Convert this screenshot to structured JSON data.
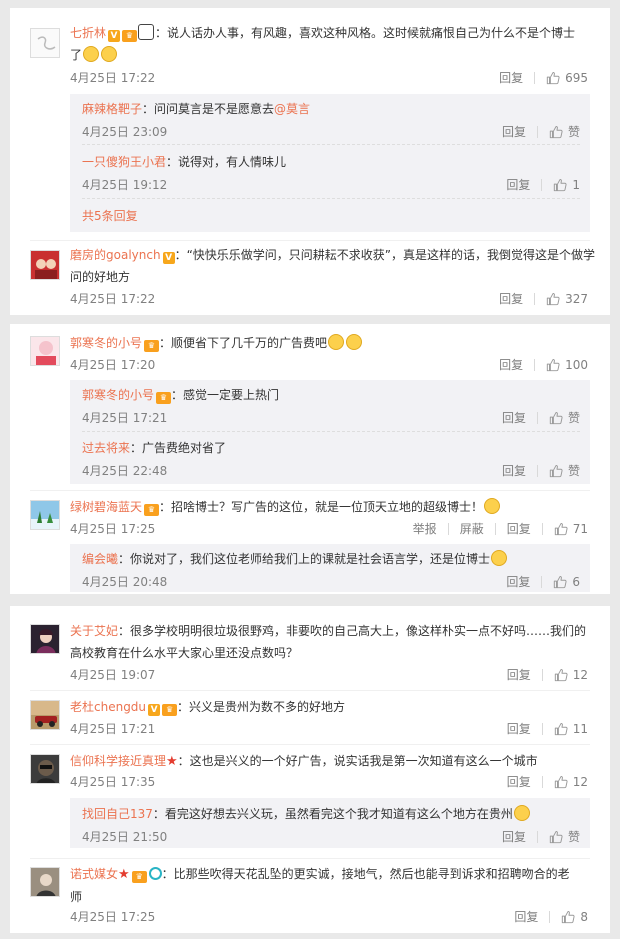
{
  "panel1": {
    "c1": {
      "name": "七折林",
      "text": "：说人话办人事，有风趣，喜欢这种风格。这时候就痛恨自己为什么不是个博士",
      "text2": "了",
      "time": "4月25日 17:22",
      "reply": "回复",
      "likes": "695",
      "subs": [
        {
          "name": "麻辣格靶子",
          "text": "：问问莫言是不是愿意去",
          "mention": "@莫言",
          "time": "4月25日 23:09",
          "reply": "回复",
          "likes": "赞"
        },
        {
          "name": "一只傻狗王小君",
          "text": "：说得对，有人情味儿",
          "time": "4月25日 19:12",
          "reply": "回复",
          "likes": "1"
        }
      ],
      "more": "共5条回复"
    },
    "c2": {
      "name": "磨房的goalynch",
      "text": "：“快快乐乐做学问，只问耕耘不求收获”，真是这样的话，我倒觉得这是个做学",
      "text2": "问的好地方",
      "time": "4月25日 17:22",
      "reply": "回复",
      "likes": "327"
    }
  },
  "panel2": {
    "c1": {
      "name": "郭寒冬的小号",
      "text": "：顺便省下了几千万的广告费吧",
      "time": "4月25日 17:20",
      "reply": "回复",
      "likes": "100",
      "subs": [
        {
          "name": "郭寒冬的小号",
          "text": "：感觉一定要上热门",
          "time": "4月25日 17:21",
          "reply": "回复",
          "likes": "赞"
        },
        {
          "name": "过去将来",
          "text": "：广告费绝对省了",
          "time": "4月25日 22:48",
          "reply": "回复",
          "likes": "赞"
        }
      ]
    },
    "c2": {
      "name": "绿树碧海蓝天",
      "text": "：招啥博士？写广告的这位，就是一位顶天立地的超级博士！",
      "time": "4月25日 17:25",
      "report": "举报",
      "block": "屏蔽",
      "reply": "回复",
      "likes": "71",
      "subs": [
        {
          "name": "编会曦",
          "text": "：你说对了，我们这位老师给我们上的课就是社会语言学，还是位博士",
          "time": "4月25日 20:48",
          "reply": "回复",
          "likes": "6"
        }
      ]
    }
  },
  "panel3": {
    "c1": {
      "name": "关于艾妃",
      "text": "：很多学校明明很垃圾很野鸡，非要吹的自己高大上，像这样朴实一点不好吗……我们的",
      "text2": "高校教育在什么水平大家心里还没点数吗？",
      "time": "4月25日 19:07",
      "reply": "回复",
      "likes": "12"
    },
    "c2": {
      "name": "老杜chengdu",
      "text": "：兴义是贵州为数不多的好地方",
      "time": "4月25日 17:21",
      "reply": "回复",
      "likes": "11"
    },
    "c3": {
      "name": "信仰科学接近真理",
      "text": "：这也是兴义的一个好广告，说实话我是第一次知道有这么一个城市",
      "time": "4月25日 17:35",
      "reply": "回复",
      "likes": "12",
      "subs": [
        {
          "name": "找回自己137",
          "text": "：看完这好想去兴义玩，虽然看完这个我才知道有这么个地方在贵州",
          "time": "4月25日 21:50",
          "reply": "回复",
          "likes": "赞"
        }
      ]
    },
    "c4": {
      "name": "诺式媒女",
      "text": "：比那些吹得天花乱坠的更实诚，接地气，然后也能寻到诉求和招聘吻合的老",
      "text2": "师",
      "time": "4月25日 17:25",
      "reply": "回复",
      "likes": "8"
    }
  },
  "colors": {
    "name": "#eb7350",
    "time": "#808080",
    "subbg": "#f2f2f5",
    "page_bg": "#e9e9e9"
  },
  "icons": [
    "thumb-up-icon",
    "vip-icon",
    "level-icon",
    "emoji-icon",
    "star-icon",
    "fan-ring-icon"
  ]
}
